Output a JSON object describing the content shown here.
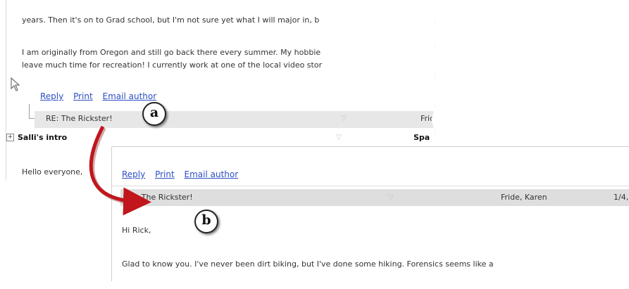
{
  "panel_a": {
    "body_lines": [
      "years.  Then it's on to Grad school, but I'm not sure yet what I will major in, b",
      "I am originally from Oregon and still go back there every summer.  My hobbie",
      "leave much time for recreation!  I currently work at one of the local video stor"
    ],
    "actions": {
      "reply": "Reply",
      "print": "Print",
      "email": "Email author"
    },
    "row1": {
      "subject": "RE: The Rickster!",
      "author": "Frid"
    },
    "row2": {
      "expander": "+",
      "subject": "Salli's intro",
      "author": "Spa"
    },
    "hello_text": "Hello everyone,"
  },
  "panel_b": {
    "actions": {
      "reply": "Reply",
      "print": "Print",
      "email": "Email author"
    },
    "row": {
      "subject": "RE: The Rickster!",
      "author": "Fride, Karen",
      "date": "1/4,"
    },
    "greeting": "Hi Rick,",
    "body_line": "Glad to know you.  I've never been dirt biking, but I've done some hiking.  Forensics seems like a"
  },
  "callouts": {
    "a": "a",
    "b": "b"
  },
  "colors": {
    "link": "#2d4fc4",
    "arrow": "#c0161c",
    "row_bg": "#e7e7e7"
  },
  "icons": {
    "sort_arrow": "sort-down-arrow-icon",
    "cursor": "mouse-pointer-icon"
  }
}
